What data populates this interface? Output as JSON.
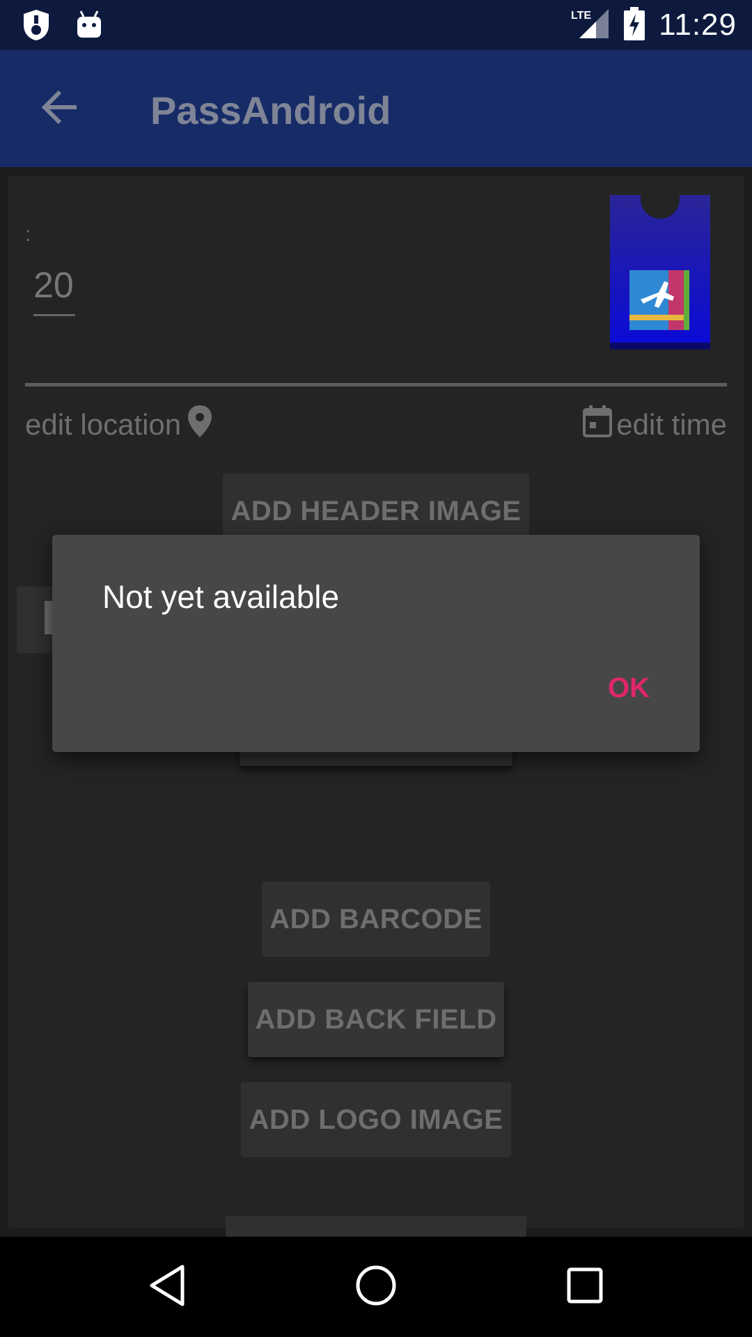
{
  "status_bar": {
    "time": "11:29",
    "network": "LTE",
    "icons": [
      "shield-icon",
      "android-icon",
      "lte-signal-icon",
      "battery-charging-icon"
    ]
  },
  "app_bar": {
    "title": "PassAndroid",
    "back_icon": "arrow-back-icon"
  },
  "pass": {
    "label": ":",
    "value": "20",
    "thumbnail_icon": "airplane-pass-icon",
    "edit_location_label": "edit location",
    "edit_time_label": "edit time"
  },
  "buttons": {
    "add_header_image": "ADD HEADER IMAGE",
    "add_barcode": "ADD BARCODE",
    "add_back_field": "ADD BACK FIELD",
    "add_logo_image": "ADD LOGO IMAGE"
  },
  "dialog": {
    "message": "Not yet available",
    "ok_label": "OK"
  },
  "colors": {
    "status_bar": "#0d1a3e",
    "app_bar": "#172c67",
    "accent": "#e0266b",
    "dialog_bg": "#474747"
  }
}
